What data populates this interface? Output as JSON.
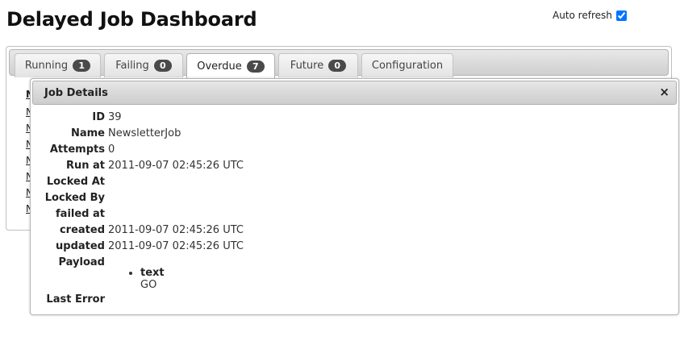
{
  "page": {
    "title": "Delayed Job Dashboard",
    "auto_refresh_label": "Auto refresh",
    "auto_refresh_checked": true
  },
  "tabs": [
    {
      "label": "Running",
      "count": "1"
    },
    {
      "label": "Failing",
      "count": "0"
    },
    {
      "label": "Overdue",
      "count": "7",
      "active": true
    },
    {
      "label": "Future",
      "count": "0"
    },
    {
      "label": "Configuration"
    }
  ],
  "job_list": {
    "header": "N",
    "items": [
      "N",
      "N",
      "N",
      "N",
      "N",
      "N",
      "N"
    ]
  },
  "dialog": {
    "title": "Job Details",
    "close_label": "×",
    "fields": {
      "id": {
        "label": "ID",
        "value": "39"
      },
      "name": {
        "label": "Name",
        "value": "NewsletterJob"
      },
      "attempts": {
        "label": "Attempts",
        "value": "0"
      },
      "run_at": {
        "label": "Run at",
        "value": "2011-09-07 02:45:26 UTC"
      },
      "locked_at": {
        "label": "Locked At",
        "value": ""
      },
      "locked_by": {
        "label": "Locked By",
        "value": ""
      },
      "failed_at": {
        "label": "failed at",
        "value": ""
      },
      "created": {
        "label": "created",
        "value": "2011-09-07 02:45:26 UTC"
      },
      "updated": {
        "label": "updated",
        "value": "2011-09-07 02:45:26 UTC"
      },
      "payload": {
        "label": "Payload",
        "items": [
          {
            "key": "text",
            "value": "GO"
          }
        ]
      },
      "last_error": {
        "label": "Last Error",
        "value": ""
      }
    }
  }
}
